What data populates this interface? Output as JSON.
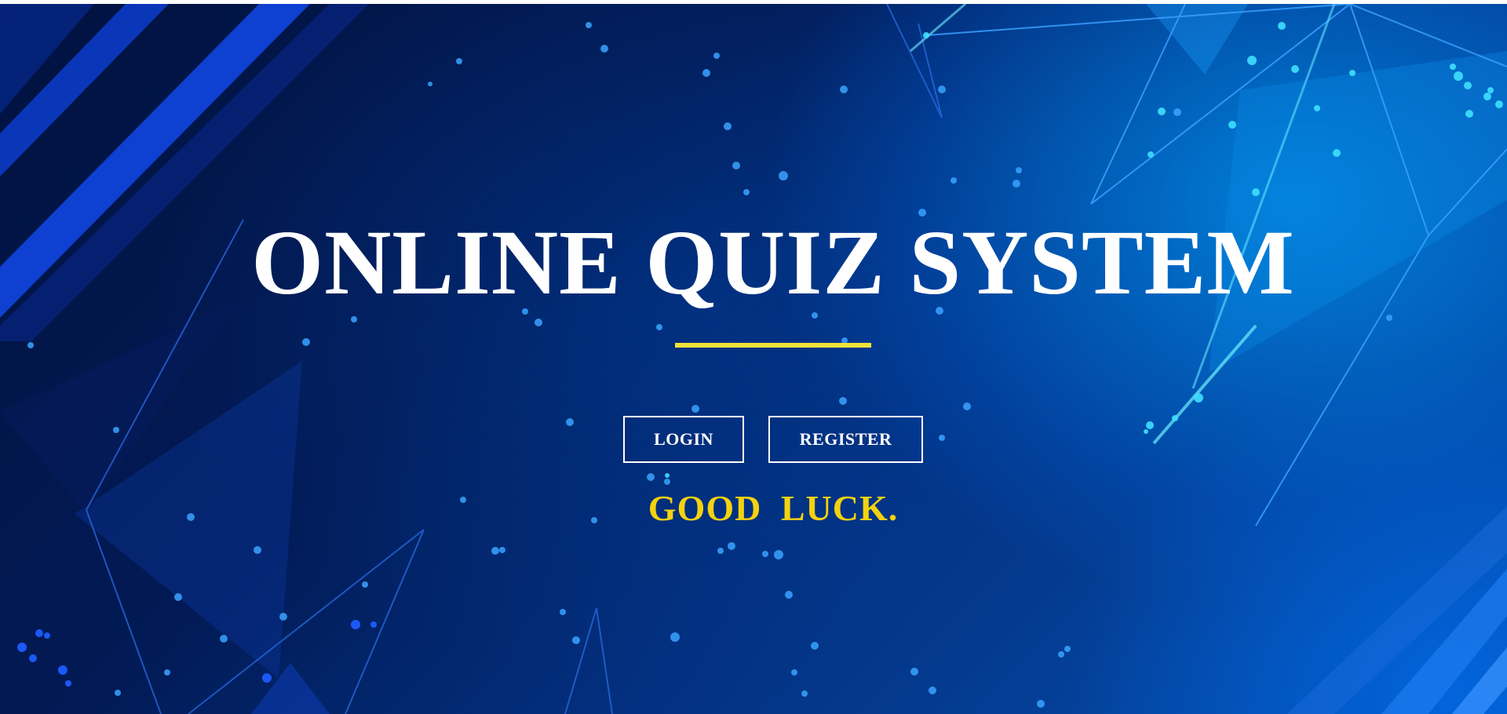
{
  "hero": {
    "title": "ONLINE QUIZ SYSTEM",
    "tagline": "GOOD  LUCK."
  },
  "actions": {
    "login_label": "LOGIN",
    "register_label": "REGISTER"
  },
  "colors": {
    "background_dark": "#01123f",
    "background_light": "#0550b0",
    "title": "#ffffff",
    "underline_accent": "#f0e33a",
    "tagline": "#f3d20f",
    "button_border": "#ffffff"
  }
}
